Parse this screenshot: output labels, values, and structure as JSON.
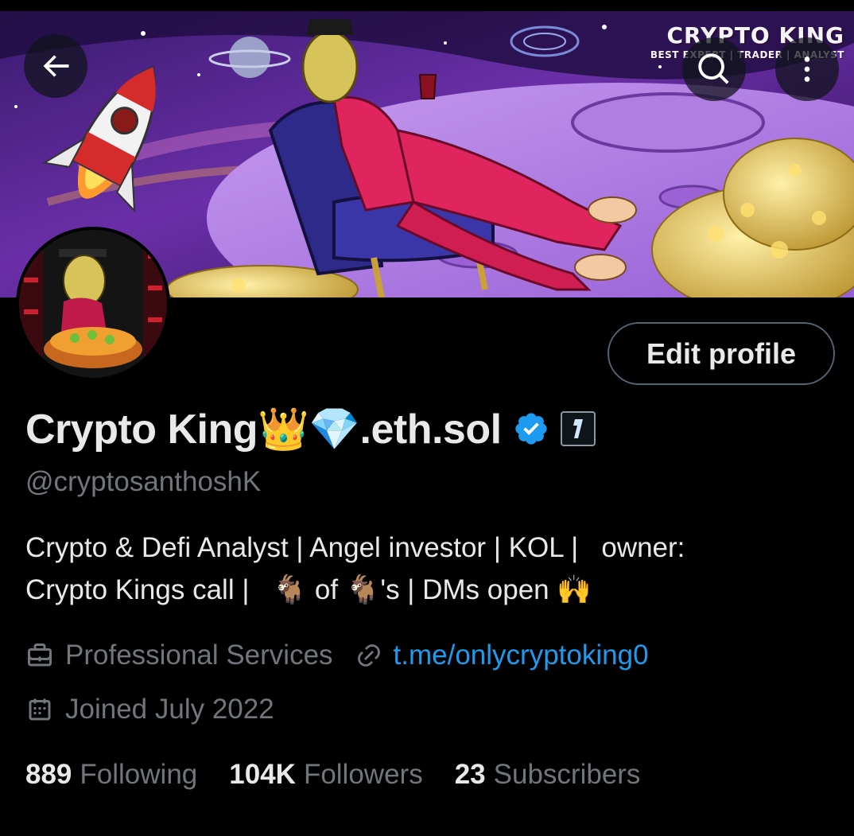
{
  "banner": {
    "brand_title": "CRYPTO KING",
    "brand_subtitle": "BEST EXPERT | TRADER | ANALYST"
  },
  "header": {
    "back_icon": "arrow-left-icon",
    "search_icon": "search-icon",
    "more_icon": "more-vertical-icon"
  },
  "profile": {
    "display_name": "Crypto King👑💎.eth.sol",
    "verified": true,
    "handle": "@cryptosanthoshK",
    "edit_button_label": "Edit profile",
    "bio_lines": [
      "Crypto & Defi Analyst | Angel investor | KOL |   owner:",
      "Crypto Kings call |   🐐 of 🐐's | DMs open 🙌"
    ],
    "category": "Professional Services",
    "link": "t.me/onlycryptoking0",
    "joined": "Joined July 2022"
  },
  "stats": {
    "following_count": "889",
    "following_label": "Following",
    "followers_count": "104K",
    "followers_label": "Followers",
    "subscribers_count": "23",
    "subscribers_label": "Subscribers"
  },
  "colors": {
    "background": "#000000",
    "text_primary": "#e7e9ea",
    "text_secondary": "#71767b",
    "link": "#1d9bf0",
    "verified": "#1d9bf0",
    "button_border": "#536471"
  }
}
